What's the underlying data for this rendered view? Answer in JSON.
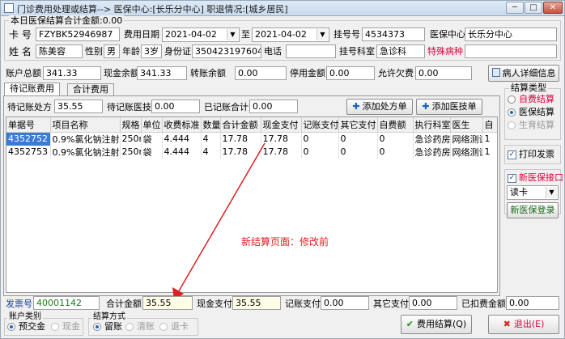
{
  "title": "门诊费用处理或结算--> 医保中心:[长乐分中心] 职退情况:[城乡居民]",
  "summary_label": "本日医保结算合计金额:0.00",
  "patient": {
    "card_no_label": "卡  号",
    "card_no": "FZYBK52946987",
    "fee_date_label": "费用日期",
    "date_from": "2021-04-02",
    "date_to_label": "至",
    "date_to": "2021-04-02",
    "reg_no_label": "挂号号",
    "reg_no": "4534373",
    "center_label": "医保中心",
    "center": "长乐分中心",
    "name_label": "姓  名",
    "name": "陈美容",
    "sex_label": "性别",
    "sex": "男",
    "age_label": "年龄",
    "age": "3岁",
    "id_label": "身份证",
    "id_no": "35042319760430",
    "phone_label": "电话",
    "phone": "",
    "dept_label": "挂号科室",
    "dept": "急诊科",
    "special_label": "特殊病种",
    "special": ""
  },
  "account": {
    "total_label": "账户总额",
    "total": "341.33",
    "cash_label": "现金余额",
    "cash": "341.33",
    "transfer_label": "转账余额",
    "transfer": "0.00",
    "stop_label": "停用金额",
    "stop": "0.00",
    "owe_label": "允许欠费",
    "owe": "0.00",
    "detail_button": "病人详细信息"
  },
  "tabs": [
    {
      "label": "待记账费用"
    },
    {
      "label": "合计费用"
    }
  ],
  "pending": {
    "presc_label": "待记账处方",
    "presc": "35.55",
    "order_label": "待记账医技",
    "order": "0.00",
    "done_label": "已记账合计",
    "done": "0.00",
    "add_presc": "添加处方单",
    "add_order": "添加医技单"
  },
  "grid": {
    "columns": [
      "单据号",
      "项目名称",
      "规格",
      "单位",
      "收费标准",
      "数量",
      "合计金额",
      "现金支付",
      "记账支付",
      "其它支付",
      "自费额",
      "执行科室",
      "医生",
      "自"
    ],
    "rows": [
      [
        "4352752",
        "0.9%氯化钠注射液",
        "250m",
        "袋",
        "4.444",
        "4",
        "17.78",
        "17.78",
        "0",
        "0",
        "0",
        "急诊药房",
        "网络测试",
        "1"
      ],
      [
        "4352753",
        "0.9%氯化钠注射液",
        "250m",
        "袋",
        "4.444",
        "4",
        "17.78",
        "17.78",
        "0",
        "0",
        "0",
        "急诊药房",
        "网络测试",
        "1"
      ]
    ]
  },
  "settle_type": {
    "title": "结算类型",
    "options": [
      "自费结算",
      "医保结算",
      "生育结算"
    ],
    "selected": "医保结算"
  },
  "print_invoice_label": "打印发票",
  "new_insurance_label": "新医保接口",
  "read_card": "读卡",
  "login_button": "新医保登录",
  "annotation": "新结算页面：修改前",
  "footer": {
    "invoice_label": "发票号",
    "invoice": "40001142",
    "total_label": "合计金额",
    "total": "35.55",
    "cash_label": "现金支付",
    "cash": "35.55",
    "acc_label": "记账支付",
    "acc": "0.00",
    "other_label": "其它支付",
    "other": "0.00",
    "deducted_label": "已扣费金额",
    "deducted": "0.00"
  },
  "account_type": {
    "title": "账户类别",
    "options": [
      "预交金",
      "现金"
    ]
  },
  "settle_mode": {
    "title": "结算方式",
    "options": [
      "留账",
      "清账",
      "退卡"
    ]
  },
  "settle_button": "费用结算(Q)",
  "exit_button": "退出(E)"
}
